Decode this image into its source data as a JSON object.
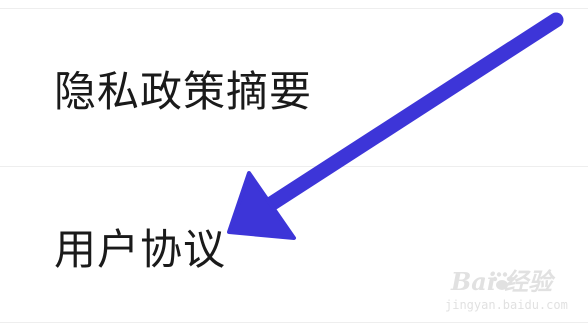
{
  "settings": {
    "items": [
      {
        "label": "隐私政策摘要"
      },
      {
        "label": "用户协议"
      }
    ]
  },
  "annotation": {
    "arrow_color": "#3d35d8",
    "arrow_target": "用户协议"
  },
  "watermark": {
    "logo_text": "Bai  经验",
    "sub_text": "jingyan.baidu.com"
  },
  "colors": {
    "background": "#ffffff",
    "text": "#1a1a1a",
    "divider": "#eeeeee"
  }
}
